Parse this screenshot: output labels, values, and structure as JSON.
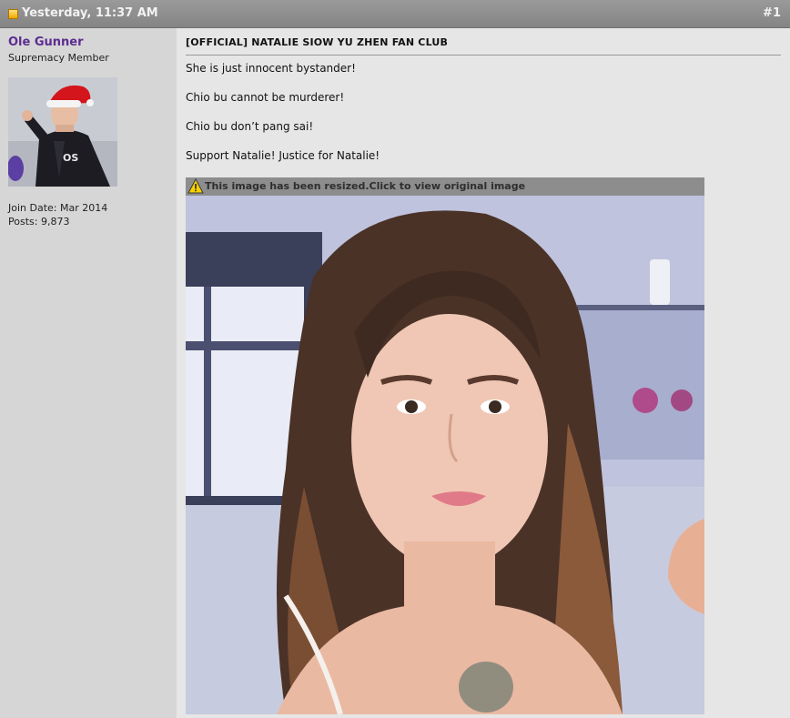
{
  "post": {
    "date": "Yesterday, 11:37 AM",
    "number": "#1",
    "title": "[OFFICIAL] NATALIE SIOW YU ZHEN FAN CLUB",
    "lines": [
      "She is just innocent bystander!",
      "Chio bu cannot be murderer!",
      "Chio bu don’t pang sai!",
      "Support Natalie! Justice for Natalie!"
    ],
    "resize_notice": "This image has been resized.Click to view original image"
  },
  "user": {
    "name": "Ole Gunner",
    "title": "Supremacy Member",
    "join_date": "Join Date: Mar 2014",
    "posts": "Posts: 9,873"
  },
  "colors": {
    "header_bg": "#8f8f8f",
    "username": "#5c2d91",
    "sidebar_bg": "#d6d6d6",
    "content_bg": "#e6e6e6"
  },
  "icons": [
    "post-status-icon",
    "warning-icon"
  ]
}
